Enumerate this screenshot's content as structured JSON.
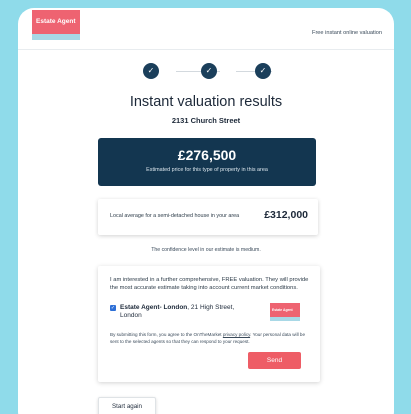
{
  "header": {
    "logo_text": "Estate Agent",
    "link_text": "Free instant online valuation"
  },
  "steps": [
    {
      "icon": "check-icon",
      "glyph": "✓"
    },
    {
      "icon": "check-icon",
      "glyph": "✓"
    },
    {
      "icon": "check-icon",
      "glyph": "✓"
    }
  ],
  "title": "Instant valuation results",
  "address": "2131 Church Street",
  "estimate": {
    "price": "£276,500",
    "caption": "Estimated price for this type of property in this area"
  },
  "local_average": {
    "label": "Local average for a semi-detached house in your area",
    "value": "£312,000"
  },
  "confidence_text": "The confidence level in our estimate is medium.",
  "form": {
    "interest_text": "I am interested in a further comprehensive, FREE valuation. They will provide the most accurate estimate taking into account current market conditions.",
    "agent_checked": true,
    "agent_name": "Estate Agent- London",
    "agent_address": ", 21 High Street, London",
    "agent_logo_text": "Estate Agent",
    "legal_prefix": "By submitting this form, you agree to the OnTheMarket ",
    "legal_link": "privacy policy",
    "legal_suffix": ". Your personal data will be sent to the selected agents so that they can respond to your request.",
    "send_label": "Send"
  },
  "start_again_label": "Start again",
  "colors": {
    "background": "#8fdbea",
    "brand_red": "#ee6371",
    "navy": "#133650",
    "step_navy": "#1b3f5b"
  }
}
